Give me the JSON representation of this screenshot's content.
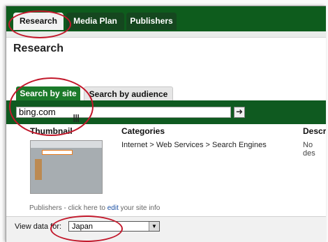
{
  "tabs": [
    {
      "label": "Research",
      "active": true
    },
    {
      "label": "Media Plan",
      "active": false
    },
    {
      "label": "Publishers",
      "active": false
    }
  ],
  "page_title": "Research",
  "subtabs": [
    {
      "label": "Search by site",
      "active": true
    },
    {
      "label": "Search by audience",
      "active": false
    }
  ],
  "search": {
    "value": "bing.com",
    "go_icon": "arrow-right"
  },
  "columns": {
    "thumbnail": "Thumbnail",
    "categories": "Categories",
    "description": "Descrip"
  },
  "category_value": "Internet > Web Services > Search Engines",
  "description_value": "No des",
  "publishers_note": {
    "prefix": "Publishers - click here to ",
    "link": "edit",
    "suffix": " your site info"
  },
  "view_data": {
    "label": "View data for:",
    "selected": "Japan"
  },
  "colors": {
    "header_green": "#0e5c1d",
    "highlight_ring": "#c2182b"
  }
}
